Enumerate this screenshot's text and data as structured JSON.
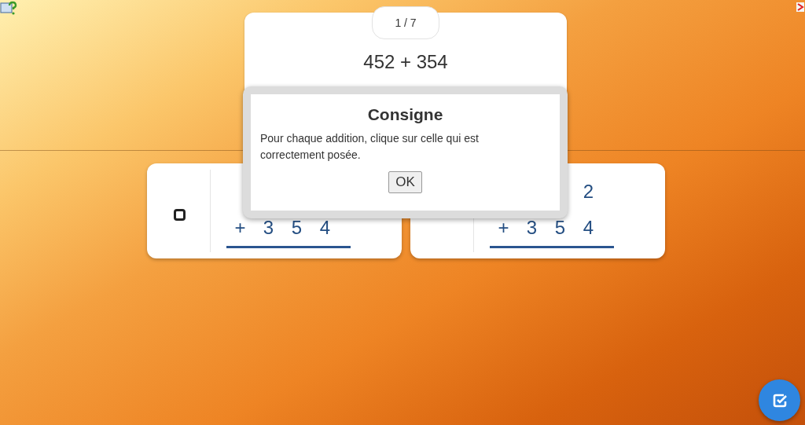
{
  "question": {
    "counter": "1 / 7",
    "expression": "452 + 354"
  },
  "answers": [
    {
      "checked": false,
      "rows": [
        [
          "+",
          "3",
          "5",
          "4"
        ]
      ]
    },
    {
      "rows": [
        [
          "",
          "",
          "",
          "2"
        ],
        [
          "+",
          "3",
          "5",
          "4"
        ]
      ]
    }
  ],
  "dialog": {
    "title": "Consigne",
    "text": "Pour chaque addition, clique sur celle qui est correctement posée.",
    "button": "OK"
  }
}
